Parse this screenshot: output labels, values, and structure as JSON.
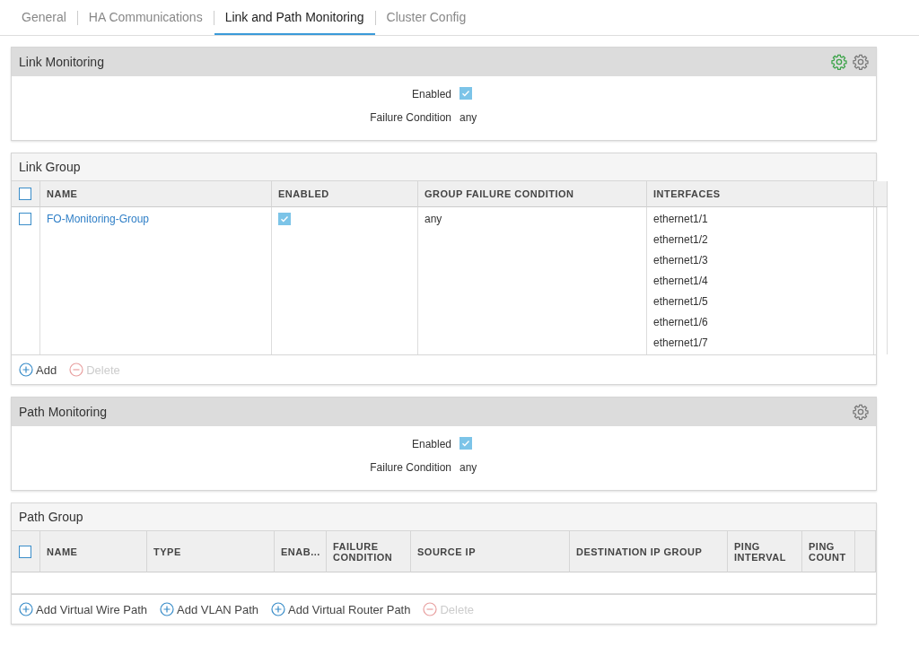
{
  "tabs": [
    {
      "label": "General",
      "selected": false
    },
    {
      "label": "HA Communications",
      "selected": false
    },
    {
      "label": "Link and Path Monitoring",
      "selected": true
    },
    {
      "label": "Cluster Config",
      "selected": false
    }
  ],
  "link_monitoring": {
    "title": "Link Monitoring",
    "status_on": true,
    "enabled_label": "Enabled",
    "enabled": true,
    "failure_label": "Failure Condition",
    "failure_value": "any"
  },
  "link_group": {
    "title": "Link Group",
    "select_all": {
      "checked": false
    },
    "columns": [
      "NAME",
      "ENABLED",
      "GROUP FAILURE CONDITION",
      "INTERFACES"
    ],
    "rows": [
      {
        "checked": false,
        "name": "FO-Monitoring-Group",
        "enabled": true,
        "condition": "any",
        "interfaces": [
          "ethernet1/1",
          "ethernet1/2",
          "ethernet1/3",
          "ethernet1/4",
          "ethernet1/5",
          "ethernet1/6",
          "ethernet1/7"
        ]
      }
    ],
    "actions": [
      {
        "label": "Add",
        "kind": "add",
        "disabled": false
      },
      {
        "label": "Delete",
        "kind": "delete",
        "disabled": true
      }
    ]
  },
  "path_monitoring": {
    "title": "Path Monitoring",
    "enabled_label": "Enabled",
    "enabled": true,
    "failure_label": "Failure Condition",
    "failure_value": "any"
  },
  "path_group": {
    "title": "Path Group",
    "select_all": {
      "checked": false
    },
    "columns": [
      "NAME",
      "TYPE",
      "ENAB...",
      "FAILURE CONDITION",
      "SOURCE IP",
      "DESTINATION IP GROUP",
      "PING INTERVAL",
      "PING COUNT"
    ],
    "actions": [
      {
        "label": "Add Virtual Wire Path",
        "kind": "add",
        "disabled": false
      },
      {
        "label": "Add VLAN Path",
        "kind": "add",
        "disabled": false
      },
      {
        "label": "Add Virtual Router Path",
        "kind": "add",
        "disabled": false
      },
      {
        "label": "Delete",
        "kind": "delete",
        "disabled": true
      }
    ]
  }
}
